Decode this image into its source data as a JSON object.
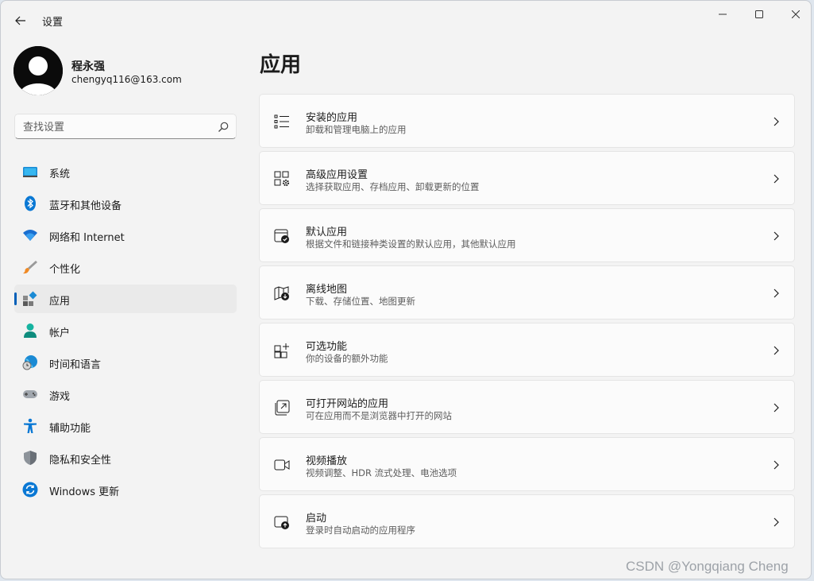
{
  "window": {
    "title": "设置"
  },
  "profile": {
    "name": "程永强",
    "email": "chengyq116@163.com"
  },
  "search": {
    "placeholder": "查找设置",
    "value": ""
  },
  "nav": {
    "items": [
      {
        "label": "系统",
        "icon": "system-icon"
      },
      {
        "label": "蓝牙和其他设备",
        "icon": "bluetooth-icon"
      },
      {
        "label": "网络和 Internet",
        "icon": "wifi-icon"
      },
      {
        "label": "个性化",
        "icon": "brush-icon"
      },
      {
        "label": "应用",
        "icon": "apps-icon",
        "selected": true
      },
      {
        "label": "帐户",
        "icon": "account-icon"
      },
      {
        "label": "时间和语言",
        "icon": "globe-clock-icon"
      },
      {
        "label": "游戏",
        "icon": "gamepad-icon"
      },
      {
        "label": "辅助功能",
        "icon": "accessibility-icon"
      },
      {
        "label": "隐私和安全性",
        "icon": "shield-icon"
      },
      {
        "label": "Windows 更新",
        "icon": "update-icon"
      }
    ]
  },
  "main": {
    "heading": "应用",
    "cards": [
      {
        "title": "安装的应用",
        "desc": "卸载和管理电脑上的应用",
        "icon": "list-icon"
      },
      {
        "title": "高级应用设置",
        "desc": "选择获取应用、存档应用、卸载更新的位置",
        "icon": "app-settings-icon"
      },
      {
        "title": "默认应用",
        "desc": "根据文件和链接种类设置的默认应用，其他默认应用",
        "icon": "default-apps-icon"
      },
      {
        "title": "离线地图",
        "desc": "下载、存储位置、地图更新",
        "icon": "map-download-icon"
      },
      {
        "title": "可选功能",
        "desc": "你的设备的额外功能",
        "icon": "add-grid-icon"
      },
      {
        "title": "可打开网站的应用",
        "desc": "可在应用而不是浏览器中打开的网站",
        "icon": "open-website-icon"
      },
      {
        "title": "视频播放",
        "desc": "视频调整、HDR 流式处理、电池选项",
        "icon": "video-icon"
      },
      {
        "title": "启动",
        "desc": "登录时自动启动的应用程序",
        "icon": "startup-icon"
      }
    ]
  },
  "watermark": "CSDN @Yongqiang Cheng",
  "colors": {
    "accent": "#005fb8",
    "background": "#f3f3f3",
    "card": "#fbfbfb"
  }
}
